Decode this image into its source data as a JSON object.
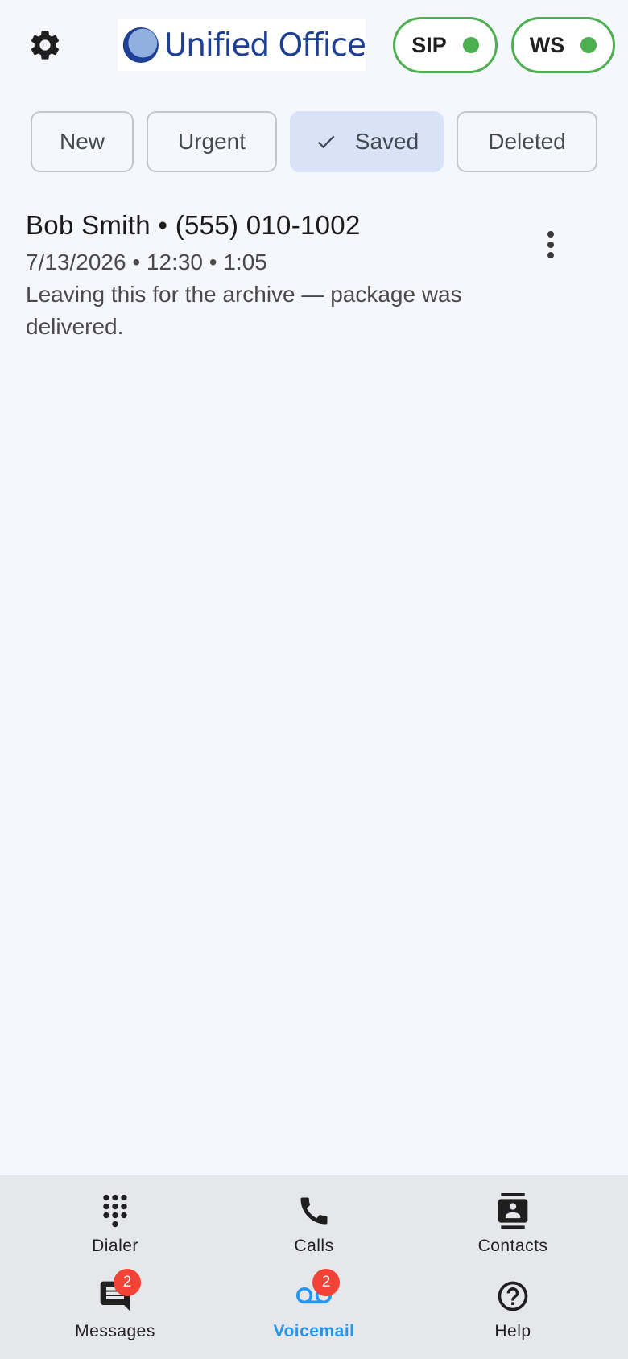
{
  "header": {
    "settings_icon": "gear-icon",
    "logo_text": "Unified Office",
    "status": [
      {
        "label": "SIP",
        "state": "connected",
        "color": "#4caf50"
      },
      {
        "label": "WS",
        "state": "connected",
        "color": "#4caf50"
      }
    ]
  },
  "filters": [
    {
      "label": "New",
      "selected": false
    },
    {
      "label": "Urgent",
      "selected": false
    },
    {
      "label": "Saved",
      "selected": true
    },
    {
      "label": "Deleted",
      "selected": false
    }
  ],
  "voicemails": [
    {
      "title": "Bob Smith • (555) 010-1002",
      "meta": "7/13/2026 • 12:30 • 1:05",
      "transcript": "Leaving this for the archive — package was delivered.",
      "menu_icon": "more-vert-icon"
    }
  ],
  "nav": {
    "dialer": {
      "label": "Dialer",
      "icon": "dialpad-icon"
    },
    "calls": {
      "label": "Calls",
      "icon": "phone-icon"
    },
    "contacts": {
      "label": "Contacts",
      "icon": "contacts-icon"
    },
    "messages": {
      "label": "Messages",
      "icon": "message-icon",
      "badge": "2"
    },
    "voicemail": {
      "label": "Voicemail",
      "icon": "voicemail-icon",
      "badge": "2",
      "active": true
    },
    "help": {
      "label": "Help",
      "icon": "help-icon"
    }
  },
  "colors": {
    "accent": "#2196f3",
    "status_ok": "#4caf50",
    "badge": "#f44336",
    "selected_chip": "#d8e3f7",
    "logo_blue": "#1e3f96"
  }
}
